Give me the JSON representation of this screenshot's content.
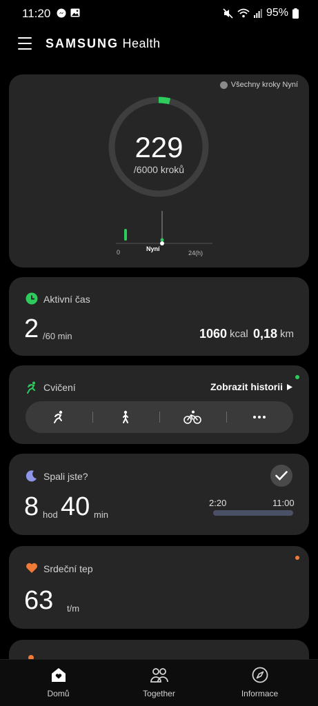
{
  "status_bar": {
    "time": "11:20",
    "battery": "95%"
  },
  "app_bar": {
    "brand_primary": "SAMSUNG",
    "brand_secondary": "Health"
  },
  "steps": {
    "tag": "Všechny kroky Nyní",
    "count": "229",
    "goal": "/6000 kroků",
    "progress_fraction": 0.038,
    "axis_start": "0",
    "axis_now": "Nyní",
    "axis_end": "24(h)",
    "accent_color": "#2ecc5c"
  },
  "active_time": {
    "title": "Aktivní čas",
    "value": "2",
    "unit": "/60 min",
    "kcal_value": "1060",
    "kcal_unit": "kcal",
    "distance_value": "0,18",
    "distance_unit": "km"
  },
  "exercise": {
    "title": "Cvičení",
    "history_label": "Zobrazit historii",
    "buttons": [
      {
        "icon": "running-icon"
      },
      {
        "icon": "walking-icon"
      },
      {
        "icon": "cycling-icon"
      },
      {
        "icon": "more-icon"
      }
    ]
  },
  "sleep": {
    "title": "Spali jste?",
    "hours": "8",
    "hours_unit": "hod",
    "minutes": "40",
    "minutes_unit": "min",
    "start": "2:20",
    "end": "11:00"
  },
  "heart": {
    "title": "Srdeční tep",
    "value": "63",
    "unit": "t/m"
  },
  "bottom_nav": {
    "items": [
      {
        "label": "Domů",
        "icon": "home-icon"
      },
      {
        "label": "Together",
        "icon": "together-icon"
      },
      {
        "label": "Informace",
        "icon": "compass-icon"
      }
    ]
  }
}
